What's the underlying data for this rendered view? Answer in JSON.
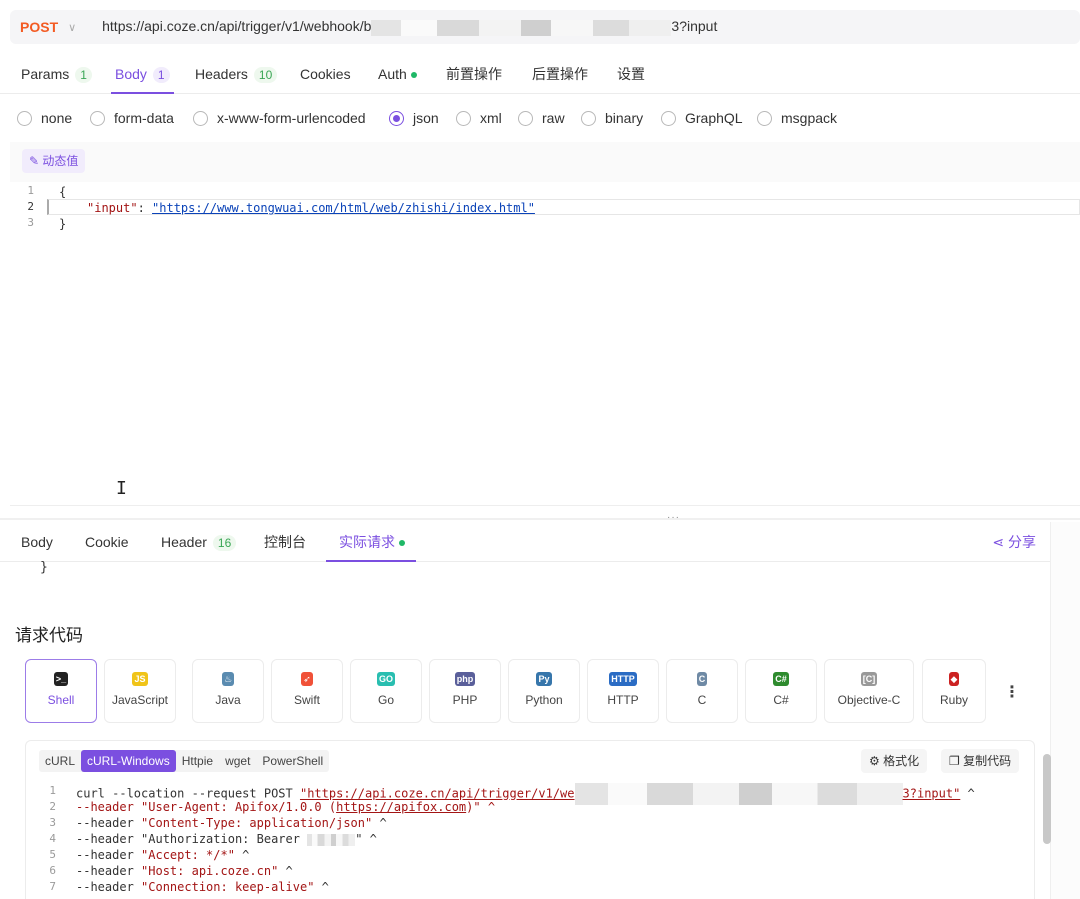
{
  "request": {
    "method": "POST",
    "url_prefix": "https://api.coze.cn/api/trigger/v1/webhook/b",
    "url_suffix": "3?input"
  },
  "req_tabs": [
    {
      "label": "Params",
      "count": "1"
    },
    {
      "label": "Body",
      "count": "1",
      "active": true
    },
    {
      "label": "Headers",
      "count": "10"
    },
    {
      "label": "Cookies"
    },
    {
      "label": "Auth"
    },
    {
      "label": "前置操作"
    },
    {
      "label": "后置操作"
    },
    {
      "label": "设置"
    }
  ],
  "body_types": [
    "none",
    "form-data",
    "x-www-form-urlencoded",
    "json",
    "xml",
    "raw",
    "binary",
    "GraphQL",
    "msgpack"
  ],
  "body_type_selected": "json",
  "dynamic_value_label": "动态值",
  "editor": {
    "line_numbers": [
      "1",
      "2",
      "3"
    ],
    "open_brace": "{",
    "key": "\"input\"",
    "colon": ": ",
    "value": "\"https://www.tongwuai.com/html/web/zhishi/index.html\"",
    "close_brace": "}"
  },
  "splitter_glyph": "···",
  "resp_tabs": [
    {
      "label": "Body"
    },
    {
      "label": "Cookie"
    },
    {
      "label": "Header",
      "count": "16"
    },
    {
      "label": "控制台"
    },
    {
      "label": "实际请求",
      "active": true
    }
  ],
  "share_label": "分享",
  "closing_brace": "}",
  "section_title": "请求代码",
  "languages": [
    {
      "name": "Shell",
      "color": "#222222",
      "glyph": ">_"
    },
    {
      "name": "JavaScript",
      "color": "#f0c419",
      "glyph": "JS"
    },
    {
      "name": "Java",
      "color": "#5a8bb0",
      "glyph": "♨"
    },
    {
      "name": "Swift",
      "color": "#f05138",
      "glyph": "➶"
    },
    {
      "name": "Go",
      "color": "#29beb0",
      "glyph": "GO"
    },
    {
      "name": "PHP",
      "color": "#5a5f9a",
      "glyph": "php"
    },
    {
      "name": "Python",
      "color": "#3776ab",
      "glyph": "Py"
    },
    {
      "name": "HTTP",
      "color": "#2b6cc4",
      "glyph": "HTTP"
    },
    {
      "name": "C",
      "color": "#6f8aa5",
      "glyph": "C"
    },
    {
      "name": "C#",
      "color": "#2e8b2e",
      "glyph": "C#"
    },
    {
      "name": "Objective-C",
      "color": "#999999",
      "glyph": "[C]"
    },
    {
      "name": "Ruby",
      "color": "#cc2222",
      "glyph": "◆"
    }
  ],
  "code_subtabs": [
    "cURL",
    "cURL-Windows",
    "Httpie",
    "wget",
    "PowerShell"
  ],
  "code_subtab_active": "cURL-Windows",
  "format_label": "格式化",
  "copy_label": "复制代码",
  "curl": {
    "line_numbers": [
      "1",
      "2",
      "3",
      "4",
      "5",
      "6",
      "7"
    ],
    "l1_prefix": "curl --location --request POST ",
    "l1_url": "\"https://api.coze.cn/api/trigger/v1/we",
    "l1_suffix": "3?input\"",
    "l1_caret": " ^",
    "l2": "--header \"User-Agent: Apifox/1.0.0 (",
    "l2_link": "https://apifox.com",
    "l2_end": ")\" ^",
    "l3": "--header \"Content-Type: application/json\" ^",
    "l4": "--header \"Authorization: Bearer ",
    "l4_end": "\" ^",
    "l5": "--header \"Accept: */*\" ^",
    "l6": "--header \"Host: api.coze.cn\" ^",
    "l7": "--header \"Connection: keep-alive\" ^"
  }
}
